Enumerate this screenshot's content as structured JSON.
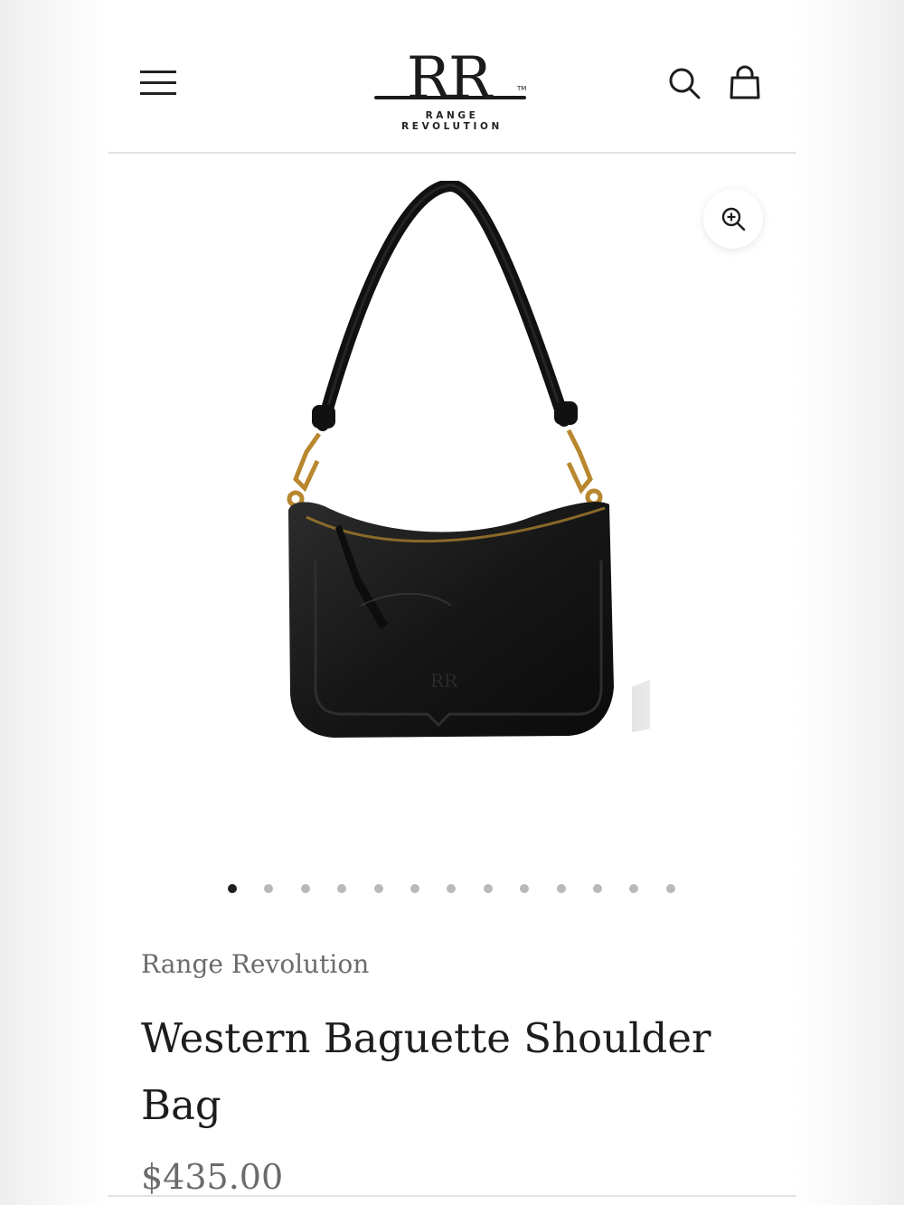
{
  "header": {
    "menu_icon": "hamburger-menu-icon",
    "logo_monogram": "RR",
    "logo_text": "RANGE REVOLUTION",
    "logo_tm": "TM",
    "search_icon": "search-icon",
    "cart_icon": "shopping-bag-icon"
  },
  "gallery": {
    "zoom_icon": "zoom-in-icon",
    "bag_stamp": "RR",
    "dot_count": 13,
    "active_dot": 0
  },
  "product": {
    "brand": "Range Revolution",
    "title": "Western Baguette Shoulder Bag",
    "price": "$435.00"
  },
  "colors": {
    "text_dark": "#1d1d1d",
    "text_muted": "#6b6b6b",
    "dot_inactive": "#b9b9b9",
    "dot_active": "#1f1f1f",
    "divider": "#e3e3e3"
  }
}
